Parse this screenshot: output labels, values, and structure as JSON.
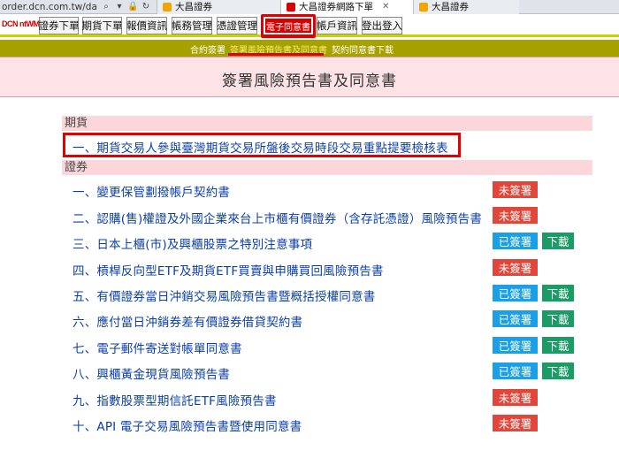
{
  "browser": {
    "url": "order.dcn.com.tw/dachang",
    "tabs": [
      {
        "label": "大昌證券",
        "active": false,
        "color": "#f2a500"
      },
      {
        "label": "大昌證券網路下單",
        "active": true,
        "color": "#d80000"
      },
      {
        "label": "大昌證券",
        "active": false,
        "color": "#f2a500"
      }
    ]
  },
  "logo": "DCN ntWMLS",
  "topnav": {
    "items": [
      "證券下單",
      "期貨下單",
      "報價資訊",
      "帳務管理",
      "憑證管理",
      "電子同意書",
      "帳戶資訊",
      "登出登入"
    ]
  },
  "subnav": {
    "items": [
      "合約簽署",
      "簽署風險預告書及同意書",
      "契約同意書下載"
    ]
  },
  "page_title": "簽署風險預告書及同意書",
  "sections": [
    {
      "title": "期貨",
      "items": [
        {
          "text": "一、期貨交易人參與臺灣期貨交易所盤後交易時段交易重點提要檢核表",
          "status": "",
          "download": ""
        }
      ]
    },
    {
      "title": "證券",
      "items": [
        {
          "text": "一、變更保管劃撥帳戶契約書",
          "status": "未簽署",
          "download": ""
        },
        {
          "text": "二、認購(售)權證及外國企業來台上市櫃有價證券（含存託憑證）風險預告書",
          "status": "未簽署",
          "download": ""
        },
        {
          "text": "三、日本上櫃(市)及興櫃股票之特別注意事項",
          "status": "已簽署",
          "download": "下載"
        },
        {
          "text": "四、槓桿反向型ETF及期貨ETF買賣與申購買回風險預告書",
          "status": "未簽署",
          "download": ""
        },
        {
          "text": "五、有價證券當日沖銷交易風險預告書暨概括授權同意書",
          "status": "已簽署",
          "download": "下載"
        },
        {
          "text": "六、應付當日沖銷券差有價證券借貸契約書",
          "status": "已簽署",
          "download": "下載"
        },
        {
          "text": "七、電子郵件寄送對帳單同意書",
          "status": "已簽署",
          "download": "下載"
        },
        {
          "text": "八、興櫃黃金現貨風險預告書",
          "status": "已簽署",
          "download": "下載"
        },
        {
          "text": "九、指數股票型期信託ETF風險預告書",
          "status": "未簽署",
          "download": ""
        },
        {
          "text": "十、API 電子交易風險預告書暨使用同意書",
          "status": "未簽署",
          "download": ""
        }
      ]
    }
  ],
  "colors": {
    "unsigned": "#e0463a",
    "signed": "#1aa0e6",
    "download": "#1b9c67",
    "link": "#0b3fa8",
    "subnav": "#a7a100",
    "highlight": "#e00000"
  }
}
